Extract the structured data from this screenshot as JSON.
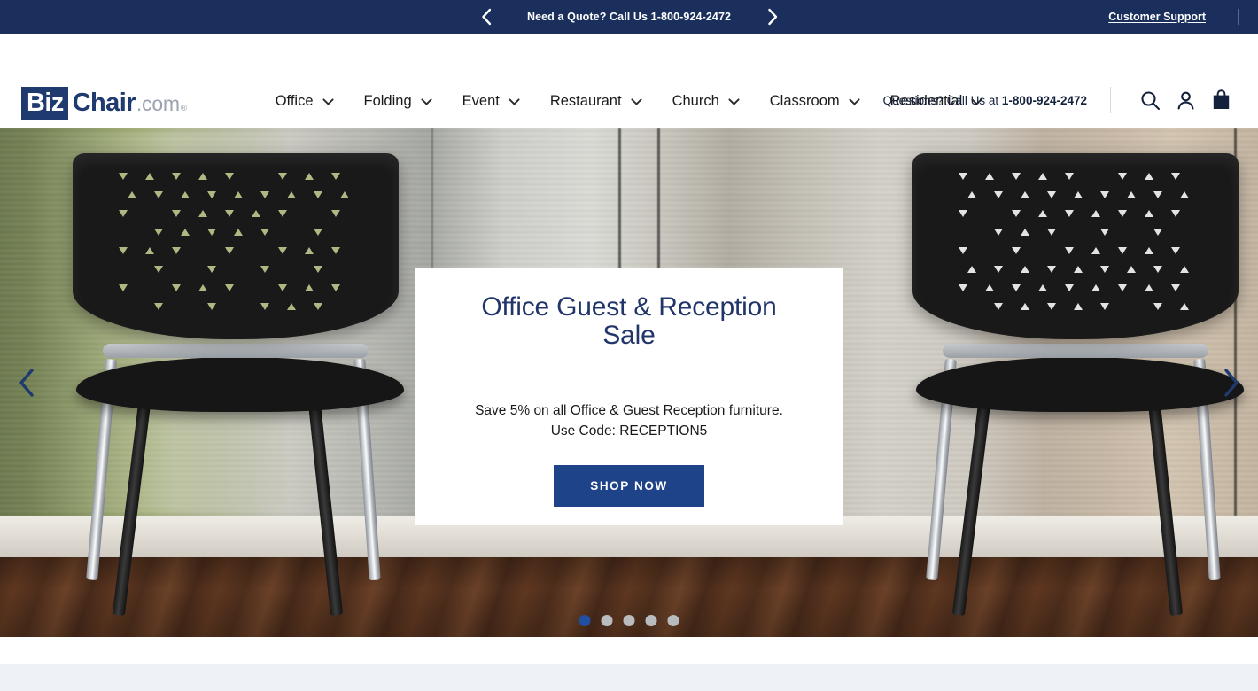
{
  "topbar": {
    "prev_icon": "chevron-left-icon",
    "next_icon": "chevron-right-icon",
    "message": "Need a Quote? Call Us 1-800-924-2472",
    "customer_support": "Customer Support",
    "bg_color": "#1b2f5c"
  },
  "header": {
    "logo": {
      "biz": "Biz",
      "chair": "Chair",
      "com": ".com",
      "registered": "®",
      "box_color": "#1f3a6e",
      "text_color": "#1f3a6e",
      "com_color": "#9aa3ae"
    },
    "phone_label": "Questions? Call Us at",
    "phone_number": "1-800-924-2472",
    "icons": [
      {
        "name": "search-icon",
        "label": "Search"
      },
      {
        "name": "account-icon",
        "label": "Account"
      },
      {
        "name": "cart-bag-icon",
        "label": "Cart"
      }
    ]
  },
  "nav": {
    "items": [
      {
        "label": "Office",
        "chevron": "chevron-down-icon"
      },
      {
        "label": "Folding",
        "chevron": "chevron-down-icon"
      },
      {
        "label": "Event",
        "chevron": "chevron-down-icon"
      },
      {
        "label": "Restaurant",
        "chevron": "chevron-down-icon"
      },
      {
        "label": "Church",
        "chevron": "chevron-down-icon"
      },
      {
        "label": "Classroom",
        "chevron": "chevron-down-icon"
      },
      {
        "label": "Residential",
        "chevron": "chevron-down-icon"
      }
    ]
  },
  "hero": {
    "prev_icon": "chevron-left-icon",
    "next_icon": "chevron-right-icon",
    "title": "Office Guest & Reception Sale",
    "subtitle_line1": "Save 5% on all Office & Guest Reception furniture.",
    "subtitle_line2": "Use Code: RECEPTION5",
    "cta_label": "SHOP NOW",
    "cta_color": "#1e4389",
    "title_color": "#22356b",
    "slides_total": 5,
    "active_slide": 1,
    "background_description": "Two black stacking guest chairs with chrome frames in front of a frosted glass office partition, potted plant between them, dark hardwood floor"
  }
}
